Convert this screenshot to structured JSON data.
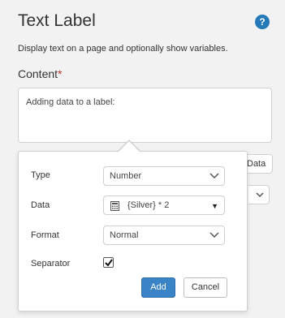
{
  "panel": {
    "title": "Text Label",
    "help_icon": "?",
    "description": "Display text on a page and optionally show variables.",
    "content_label": "Content",
    "required_marker": "*",
    "content_value": "Adding data to a label:",
    "data_button_label": "Data"
  },
  "popover": {
    "type_label": "Type",
    "type_value": "Number",
    "data_label": "Data",
    "data_value": "{Silver} * 2",
    "format_label": "Format",
    "format_value": "Normal",
    "separator_label": "Separator",
    "separator_checked": true,
    "add_label": "Add",
    "cancel_label": "Cancel"
  },
  "colors": {
    "accent": "#2479b9",
    "add_button": "#3a83c7",
    "background": "#f2f2f2",
    "required": "#c0392b"
  },
  "icons": [
    "help-icon",
    "chevron-down-icon",
    "calculator-icon",
    "caret-down-icon",
    "checkmark-icon"
  ]
}
